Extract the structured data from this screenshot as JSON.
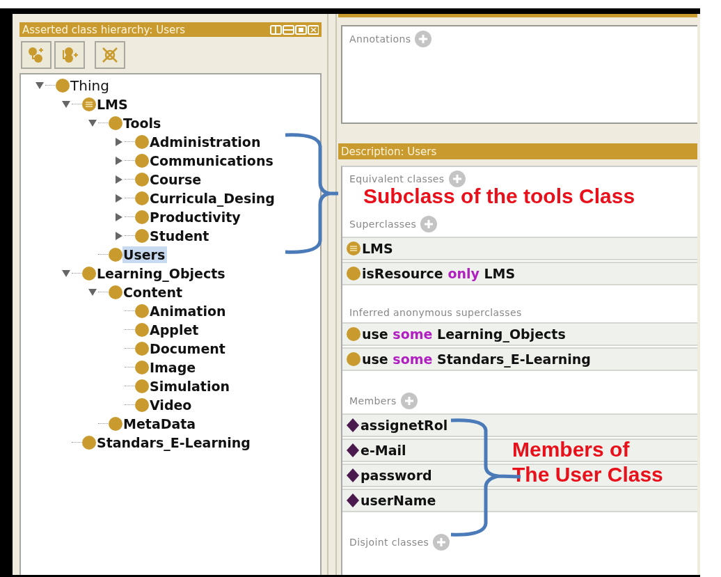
{
  "hierarchy_panel": {
    "title": "Asserted class hierarchy: Users"
  },
  "tree": [
    {
      "label": "Thing",
      "kind": "class",
      "expanded": true,
      "selected": false,
      "children": [
        {
          "label": "LMS",
          "kind": "defined",
          "expanded": true,
          "selected": false,
          "children": [
            {
              "label": "Tools",
              "kind": "class",
              "expanded": true,
              "selected": false,
              "children": [
                {
                  "label": "Administration",
                  "kind": "class",
                  "expanded": false,
                  "selected": false
                },
                {
                  "label": "Communications",
                  "kind": "class",
                  "expanded": false,
                  "selected": false
                },
                {
                  "label": "Course",
                  "kind": "class",
                  "expanded": false,
                  "selected": false
                },
                {
                  "label": "Curricula_Desing",
                  "kind": "class",
                  "expanded": false,
                  "selected": false
                },
                {
                  "label": "Productivity",
                  "kind": "class",
                  "expanded": false,
                  "selected": false
                },
                {
                  "label": "Student",
                  "kind": "class",
                  "expanded": false,
                  "selected": false
                }
              ]
            },
            {
              "label": "Users",
              "kind": "class",
              "selected": true
            }
          ]
        },
        {
          "label": "Learning_Objects",
          "kind": "class",
          "expanded": true,
          "selected": false,
          "children": [
            {
              "label": "Content",
              "kind": "class",
              "expanded": true,
              "selected": false,
              "children": [
                {
                  "label": "Animation",
                  "kind": "class",
                  "selected": false
                },
                {
                  "label": "Applet",
                  "kind": "class",
                  "selected": false
                },
                {
                  "label": "Document",
                  "kind": "class",
                  "selected": false
                },
                {
                  "label": "Image",
                  "kind": "class",
                  "selected": false
                },
                {
                  "label": "Simulation",
                  "kind": "class",
                  "selected": false
                },
                {
                  "label": "Video",
                  "kind": "class",
                  "selected": false
                }
              ]
            },
            {
              "label": "MetaData",
              "kind": "class",
              "selected": false
            }
          ]
        },
        {
          "label": "Standars_E-Learning",
          "kind": "class",
          "selected": false
        }
      ]
    }
  ],
  "annotations_panel": {
    "label": "Annotations",
    "addable": true
  },
  "description_panel": {
    "title": "Description: Users",
    "sections": [
      {
        "label": "Equivalent classes",
        "addable": true
      },
      {
        "label": "Superclasses",
        "addable": true,
        "rows": [
          {
            "kind": "defined",
            "parts": [
              {
                "text": "LMS",
                "kind": "name"
              }
            ]
          },
          {
            "kind": "class",
            "parts": [
              {
                "text": "isResource",
                "kind": "name"
              },
              {
                "text": "only",
                "kind": "keyword"
              },
              {
                "text": "LMS",
                "kind": "name"
              }
            ]
          }
        ]
      },
      {
        "label": "Inferred anonymous superclasses",
        "addable": false,
        "rows": [
          {
            "kind": "class",
            "parts": [
              {
                "text": "use",
                "kind": "name"
              },
              {
                "text": "some",
                "kind": "keyword"
              },
              {
                "text": "Learning_Objects",
                "kind": "name"
              }
            ]
          },
          {
            "kind": "class",
            "parts": [
              {
                "text": "use",
                "kind": "name"
              },
              {
                "text": "some",
                "kind": "keyword"
              },
              {
                "text": "Standars_E-Learning",
                "kind": "name"
              }
            ]
          }
        ]
      },
      {
        "label": "Members",
        "addable": true,
        "rows": [
          {
            "kind": "individual",
            "parts": [
              {
                "text": "assignetRol",
                "kind": "name"
              }
            ]
          },
          {
            "kind": "individual",
            "parts": [
              {
                "text": "e-Mail",
                "kind": "name"
              }
            ],
            "note": "Members of"
          },
          {
            "kind": "individual",
            "parts": [
              {
                "text": "password",
                "kind": "name"
              }
            ],
            "note": "The User Class"
          },
          {
            "kind": "individual",
            "parts": [
              {
                "text": "userName",
                "kind": "name"
              }
            ]
          }
        ]
      },
      {
        "label": "Disjoint classes",
        "addable": true
      }
    ]
  },
  "callouts": [
    {
      "lines": [
        "Subclass of the tools Class"
      ]
    }
  ]
}
